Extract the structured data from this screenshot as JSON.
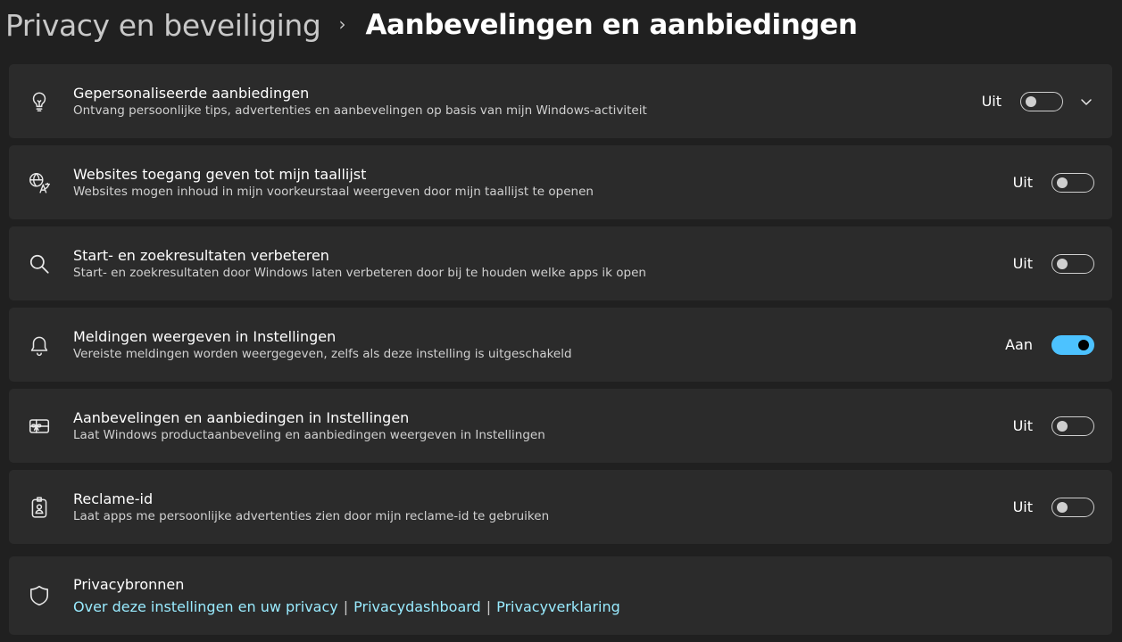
{
  "breadcrumb": {
    "parent": "Privacy en beveiliging",
    "separator": "›",
    "current": "Aanbevelingen en aanbiedingen"
  },
  "settings": [
    {
      "icon": "lightbulb-icon",
      "title": "Gepersonaliseerde aanbiedingen",
      "description": "Ontvang persoonlijke tips, advertenties en aanbevelingen op basis van mijn Windows-activiteit",
      "state": "Uit",
      "on": false,
      "expandable": true
    },
    {
      "icon": "language-icon",
      "title": "Websites toegang geven tot mijn taallijst",
      "description": "Websites mogen inhoud in mijn voorkeurstaal weergeven door mijn taallijst te openen",
      "state": "Uit",
      "on": false
    },
    {
      "icon": "search-icon",
      "title": "Start- en zoekresultaten verbeteren",
      "description": "Start- en zoekresultaten door Windows laten verbeteren door bij te houden welke apps ik open",
      "state": "Uit",
      "on": false
    },
    {
      "icon": "bell-icon",
      "title": "Meldingen weergeven in Instellingen",
      "description": "Vereiste meldingen worden weergegeven, zelfs als deze instelling is uitgeschakeld",
      "state": "Aan",
      "on": true
    },
    {
      "icon": "gift-card-icon",
      "title": "Aanbevelingen en aanbiedingen in Instellingen",
      "description": "Laat Windows productaanbeveling en aanbiedingen weergeven in Instellingen",
      "state": "Uit",
      "on": false
    },
    {
      "icon": "id-badge-icon",
      "title": "Reclame-id",
      "description": "Laat apps me persoonlijke advertenties zien door mijn reclame-id te gebruiken",
      "state": "Uit",
      "on": false
    }
  ],
  "privacy_resources": {
    "icon": "shield-icon",
    "title": "Privacybronnen",
    "links": [
      "Over deze instellingen en uw privacy",
      "Privacydashboard",
      "Privacyverklaring"
    ],
    "link_separator": "|"
  },
  "colors": {
    "background": "#202020",
    "card": "#2b2b2b",
    "accent": "#4cc2ff",
    "link": "#99ebff"
  }
}
